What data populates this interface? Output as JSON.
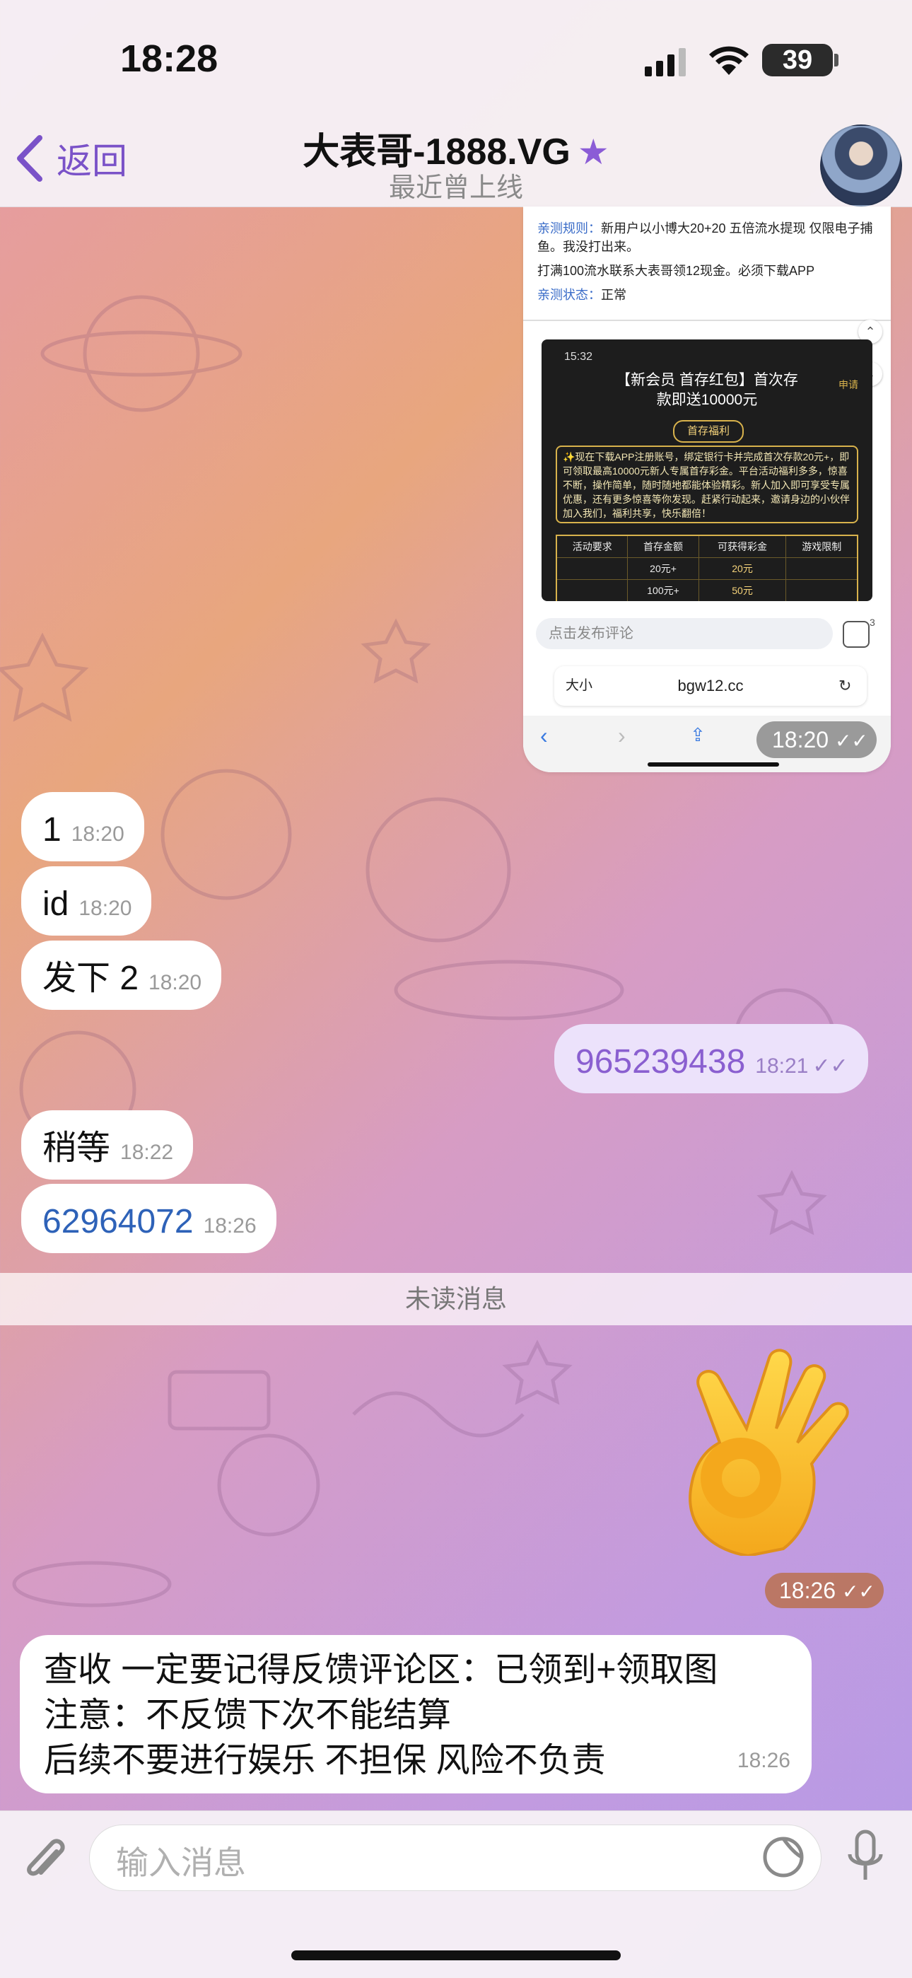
{
  "status_bar": {
    "time": "18:28",
    "battery": "39"
  },
  "header": {
    "back_label": "返回",
    "title": "大表哥-1888.VG",
    "title_star": "★",
    "subtitle": "最近曾上线"
  },
  "screenshot_message": {
    "rule_label": "亲测规则：",
    "rule_text": "新用户以小博大20+20 五倍流水提现 仅限电子捕鱼。我没打出来。",
    "note": "打满100流水联系大表哥领12现金。必须下载APP",
    "status_label": "亲测状态：",
    "status_value": "正常",
    "inner_time": "15:32",
    "inner_title_1": "【新会员 首存红包】首次存",
    "inner_title_2": "款即送10000元",
    "inner_side": "申请",
    "inner_pill": "首存福利",
    "inner_text": "✨现在下载APP注册账号，绑定银行卡并完成首次存款20元+，即可领取最高10000元新人专属首存彩金。平台活动福利多多，惊喜不断，操作简单，随时随地都能体验精彩。新人加入即可享受专属优惠，还有更多惊喜等你发现。赶紧行动起来，邀请身边的小伙伴加入我们，福利共享，快乐翻倍！",
    "table_headers": [
      "活动要求",
      "首存金额",
      "可获得彩金",
      "游戏限制"
    ],
    "table_rows": [
      [
        "",
        "20元+",
        "20元",
        ""
      ],
      [
        "",
        "100元+",
        "50元",
        ""
      ]
    ],
    "comment_placeholder": "点击发布评论",
    "comment_count": "3",
    "url_aa": "大小",
    "url": "bgw12.cc",
    "time": "18:20"
  },
  "messages": [
    {
      "text": "1",
      "time": "18:20",
      "direction": "in"
    },
    {
      "text": "id",
      "time": "18:20",
      "direction": "in"
    },
    {
      "text": "发下 2",
      "time": "18:20",
      "direction": "in"
    },
    {
      "text": "965239438",
      "time": "18:21",
      "direction": "out"
    },
    {
      "text": "稍等",
      "time": "18:22",
      "direction": "in"
    },
    {
      "text": "62964072",
      "time": "18:26",
      "direction": "in"
    }
  ],
  "unread_label": "未读消息",
  "emoji_message": {
    "emoji": "ok-hand",
    "time": "18:26"
  },
  "long_message": {
    "line1": "查收  一定要记得反馈评论区：已领到+领取图",
    "line2": "注意：不反馈下次不能结算",
    "line3": "后续不要进行娱乐 不担保 风险不负责",
    "time": "18:26"
  },
  "composer": {
    "placeholder": "输入消息"
  },
  "colors": {
    "accent": "#7a52c8",
    "link": "#2e62b8",
    "out_bubble": "#ece2fb"
  }
}
